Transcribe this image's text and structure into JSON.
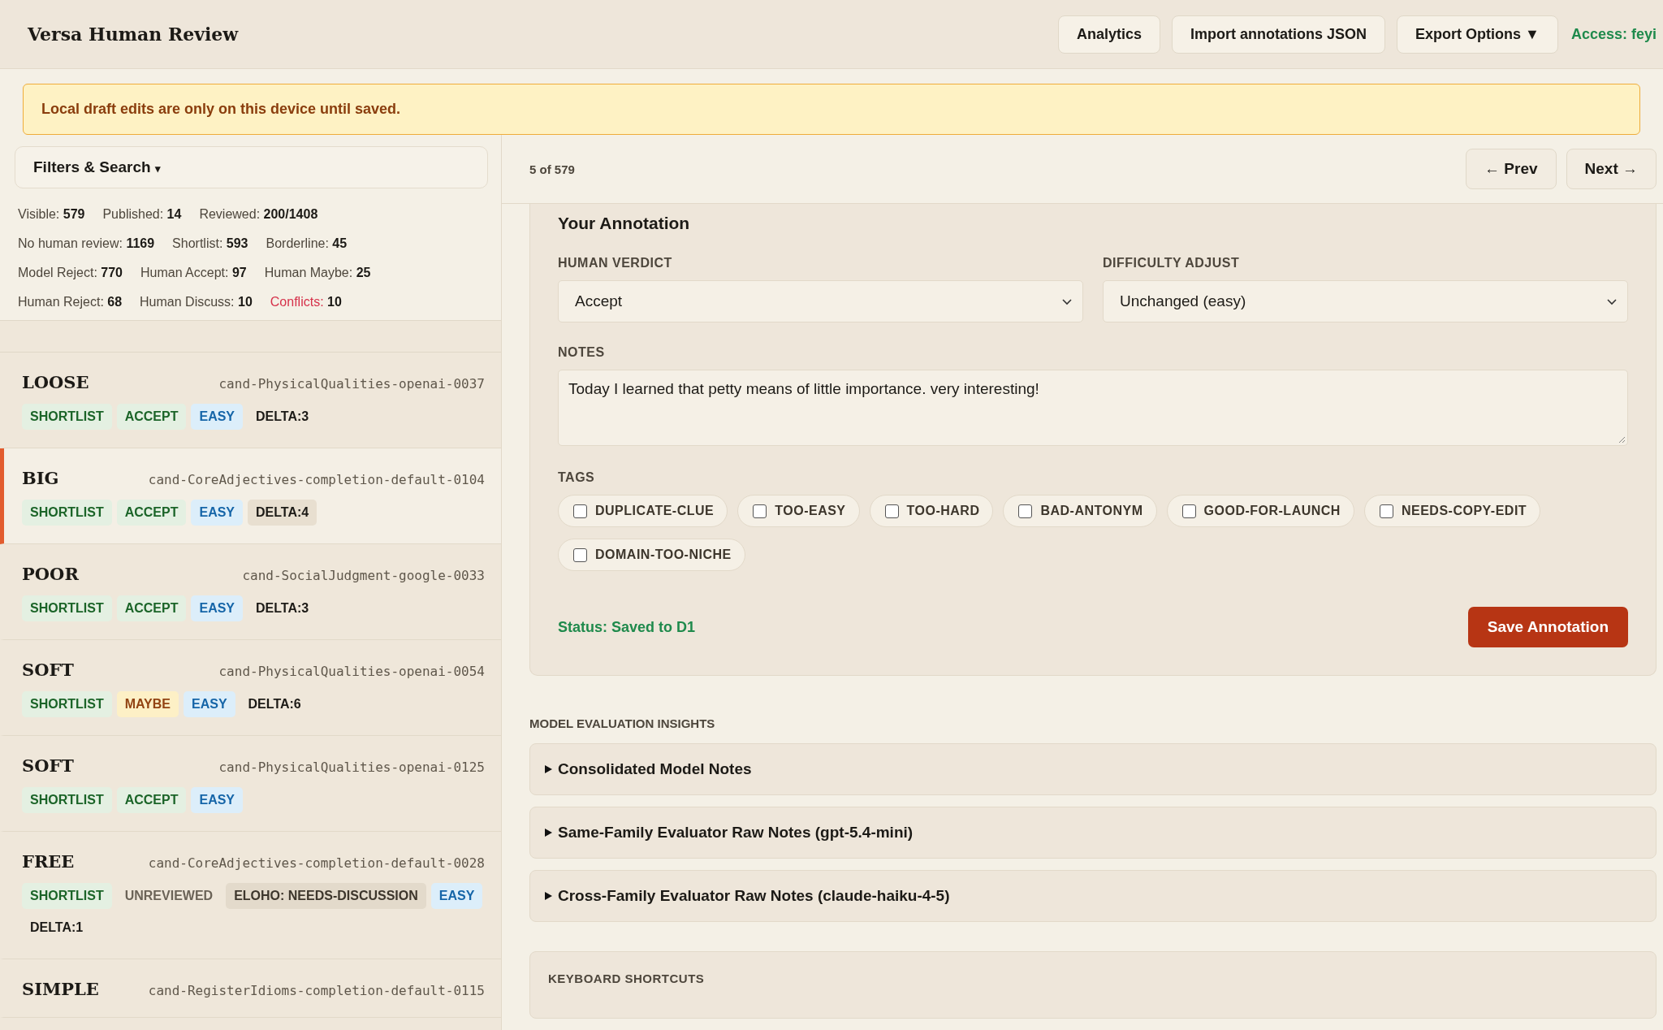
{
  "app_title": "Versa Human Review",
  "header_buttons": [
    {
      "label": "Analytics",
      "kind": "plain"
    },
    {
      "label": "Import annotations JSON",
      "kind": "plain"
    },
    {
      "label": "Export Options ▼",
      "kind": "plain"
    }
  ],
  "access": "Access: feyi",
  "banner": "Local draft edits are only on this device until saved.",
  "filters": {
    "label": "Filters & Search",
    "caret": "▾",
    "expanded": false
  },
  "stats": [
    [
      {
        "label": "Visible:",
        "value": "579",
        "warn": false
      },
      {
        "label": "Published:",
        "value": "14",
        "warn": false
      },
      {
        "label": "Reviewed:",
        "value": "200/1408",
        "warn": false
      }
    ],
    [
      {
        "label": "No human review:",
        "value": "1169",
        "warn": false
      },
      {
        "label": "Shortlist:",
        "value": "593",
        "warn": false
      },
      {
        "label": "Borderline:",
        "value": "45",
        "warn": false
      }
    ],
    [
      {
        "label": "Model Reject:",
        "value": "770",
        "warn": false
      },
      {
        "label": "Human Accept:",
        "value": "97",
        "warn": false
      },
      {
        "label": "Human Maybe:",
        "value": "25",
        "warn": false
      }
    ],
    [
      {
        "label": "Human Reject:",
        "value": "68",
        "warn": false
      },
      {
        "label": "Human Discuss:",
        "value": "10",
        "warn": false
      },
      {
        "label": "Conflicts:",
        "value": "10",
        "warn": true
      }
    ]
  ],
  "items": [
    {
      "word": "LOOSE",
      "id": "cand-PhysicalQualities-openai-0037",
      "selected": false,
      "tags": [
        {
          "text": "SHORTLIST",
          "kind": "shortlist"
        },
        {
          "text": "ACCEPT",
          "kind": "accept"
        },
        {
          "text": "EASY",
          "kind": "easy"
        },
        {
          "text": "DELTA:3",
          "kind": "delta"
        }
      ]
    },
    {
      "word": "BIG",
      "id": "cand-CoreAdjectives-completion-default-0104",
      "selected": true,
      "tags": [
        {
          "text": "SHORTLIST",
          "kind": "shortlist"
        },
        {
          "text": "ACCEPT",
          "kind": "accept"
        },
        {
          "text": "EASY",
          "kind": "easy"
        },
        {
          "text": "DELTA:4",
          "kind": "delta"
        }
      ]
    },
    {
      "word": "POOR",
      "id": "cand-SocialJudgment-google-0033",
      "selected": false,
      "tags": [
        {
          "text": "SHORTLIST",
          "kind": "shortlist"
        },
        {
          "text": "ACCEPT",
          "kind": "accept"
        },
        {
          "text": "EASY",
          "kind": "easy"
        },
        {
          "text": "DELTA:3",
          "kind": "delta"
        }
      ]
    },
    {
      "word": "SOFT",
      "id": "cand-PhysicalQualities-openai-0054",
      "selected": false,
      "tags": [
        {
          "text": "SHORTLIST",
          "kind": "shortlist"
        },
        {
          "text": "MAYBE",
          "kind": "maybe"
        },
        {
          "text": "EASY",
          "kind": "easy"
        },
        {
          "text": "DELTA:6",
          "kind": "delta"
        }
      ]
    },
    {
      "word": "SOFT",
      "id": "cand-PhysicalQualities-openai-0125",
      "selected": false,
      "tags": [
        {
          "text": "SHORTLIST",
          "kind": "shortlist"
        },
        {
          "text": "ACCEPT",
          "kind": "accept"
        },
        {
          "text": "EASY",
          "kind": "easy"
        }
      ]
    },
    {
      "word": "FREE",
      "id": "cand-CoreAdjectives-completion-default-0028",
      "selected": false,
      "tags": [
        {
          "text": "SHORTLIST",
          "kind": "shortlist"
        },
        {
          "text": "UNREVIEWED",
          "kind": "unreviewed"
        },
        {
          "text": "ELOHO: NEEDS-DISCUSSION",
          "kind": "discussion"
        },
        {
          "text": "EASY",
          "kind": "easy"
        },
        {
          "text": "DELTA:1",
          "kind": "delta"
        }
      ]
    },
    {
      "word": "SIMPLE",
      "id": "cand-RegisterIdioms-completion-default-0115",
      "selected": false
    }
  ],
  "position": "5 of 579",
  "nav": {
    "prev": "← Prev",
    "next": "Next →"
  },
  "annotation": {
    "title": "Your Annotation",
    "verdict": {
      "label": "HUMAN VERDICT",
      "value": "Accept"
    },
    "difficulty": {
      "label": "DIFFICULTY ADJUST",
      "value": "Unchanged (easy)"
    },
    "notes": {
      "label": "NOTES",
      "value": "Today I learned that petty means of little importance. very interesting!"
    },
    "tags_label": "TAGS",
    "tags": [
      {
        "label": "DUPLICATE-CLUE",
        "checked": false
      },
      {
        "label": "TOO-EASY",
        "checked": false
      },
      {
        "label": "TOO-HARD",
        "checked": false
      },
      {
        "label": "BAD-ANTONYM",
        "checked": false
      },
      {
        "label": "GOOD-FOR-LAUNCH",
        "checked": false
      },
      {
        "label": "NEEDS-COPY-EDIT",
        "checked": false
      },
      {
        "label": "DOMAIN-TOO-NICHE",
        "checked": false
      }
    ],
    "status": "Status: Saved to D1",
    "save": "Save Annotation"
  },
  "insights": {
    "title": "MODEL EVALUATION INSIGHTS",
    "sections": [
      {
        "title": "Consolidated Model Notes",
        "expanded": false
      },
      {
        "title": "Same-Family Evaluator Raw Notes (gpt-5.4-mini)",
        "expanded": false
      },
      {
        "title": "Cross-Family Evaluator Raw Notes (claude-haiku-4-5)",
        "expanded": false
      }
    ]
  },
  "shortcuts": {
    "title": "KEYBOARD SHORTCUTS"
  }
}
